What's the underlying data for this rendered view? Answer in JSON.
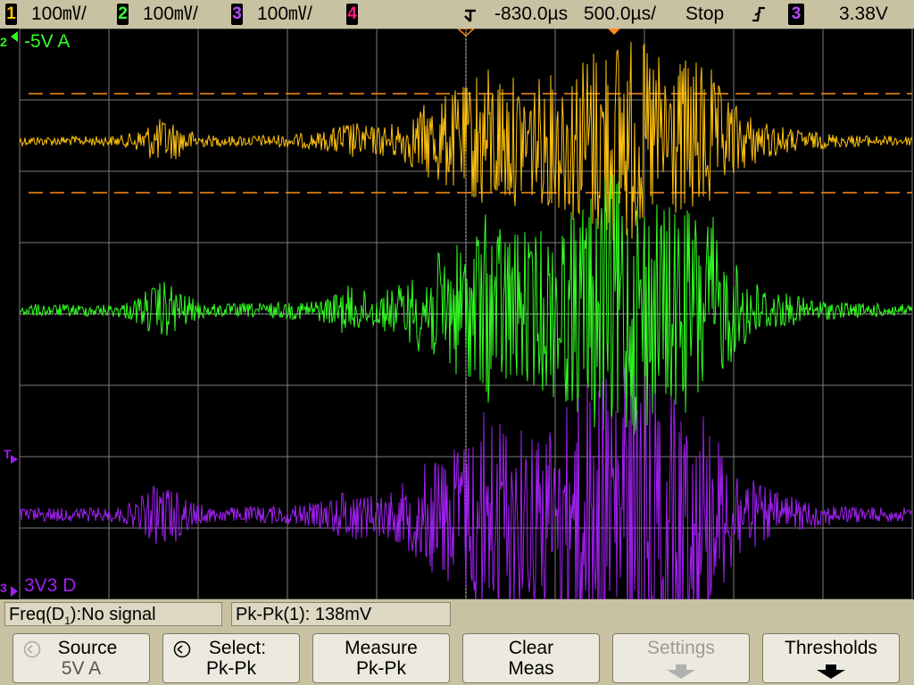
{
  "header": {
    "channels": [
      {
        "num": "1",
        "scale": "100㎷/",
        "color": "#f5c400"
      },
      {
        "num": "2",
        "scale": "100㎷/",
        "color": "#33ff33"
      },
      {
        "num": "3",
        "scale": "100㎷/",
        "color": "#9b30ff"
      },
      {
        "num": "4",
        "scale": "",
        "color": "#ff1f7a"
      }
    ],
    "delay": "-830.0µs",
    "timebase": "500.0µs/",
    "run_state": "Stop",
    "trigger_source": "3",
    "trigger_level": "3.38V"
  },
  "screen": {
    "ch2_label": "-5V  A",
    "ch2_marker": "2",
    "ch3_label": "3V3  D",
    "ch3_marker": "3",
    "trigger_marker": "T",
    "colors": {
      "ch1": "#ffc20e",
      "ch2": "#33ff22",
      "ch3": "#a020f0",
      "cursor": "#ff8c1a",
      "grid": "#7d7d7d"
    }
  },
  "measurements": {
    "freq_label": "Freq(D",
    "freq_sub": "1",
    "freq_value": "):No signal",
    "pkpk": "Pk-Pk(1): 138mV"
  },
  "softkeys": [
    {
      "line1": "Source",
      "line2": "5V  A"
    },
    {
      "line1": "Select:",
      "line2": "Pk-Pk"
    },
    {
      "line1": "Measure",
      "line2": "Pk-Pk"
    },
    {
      "line1": "Clear",
      "line2": "Meas"
    },
    {
      "line1": "Settings",
      "line2": ""
    },
    {
      "line1": "Thresholds",
      "line2": ""
    }
  ]
}
